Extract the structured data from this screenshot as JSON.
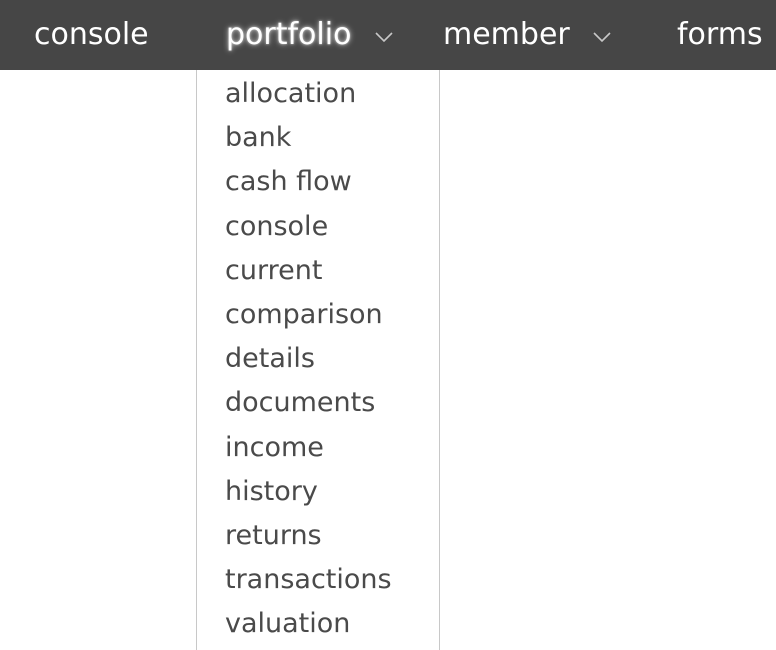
{
  "nav": {
    "items": [
      {
        "label": "console",
        "has_dropdown": false
      },
      {
        "label": "portfolio",
        "has_dropdown": true,
        "active": true
      },
      {
        "label": "member",
        "has_dropdown": true
      },
      {
        "label": "forms",
        "has_dropdown": false
      }
    ],
    "chevron_icon": "chevron-down-icon"
  },
  "dropdown": {
    "items": [
      "allocation",
      "bank",
      "cash flow",
      "console",
      "current",
      "comparison",
      "details",
      "documents",
      "income",
      "history",
      "returns",
      "transactions",
      "valuation"
    ]
  },
  "colors": {
    "navbar_bg": "#464646",
    "nav_text": "#ffffff",
    "menu_text": "#4a4a4a",
    "menu_border": "#c8c8c8"
  }
}
